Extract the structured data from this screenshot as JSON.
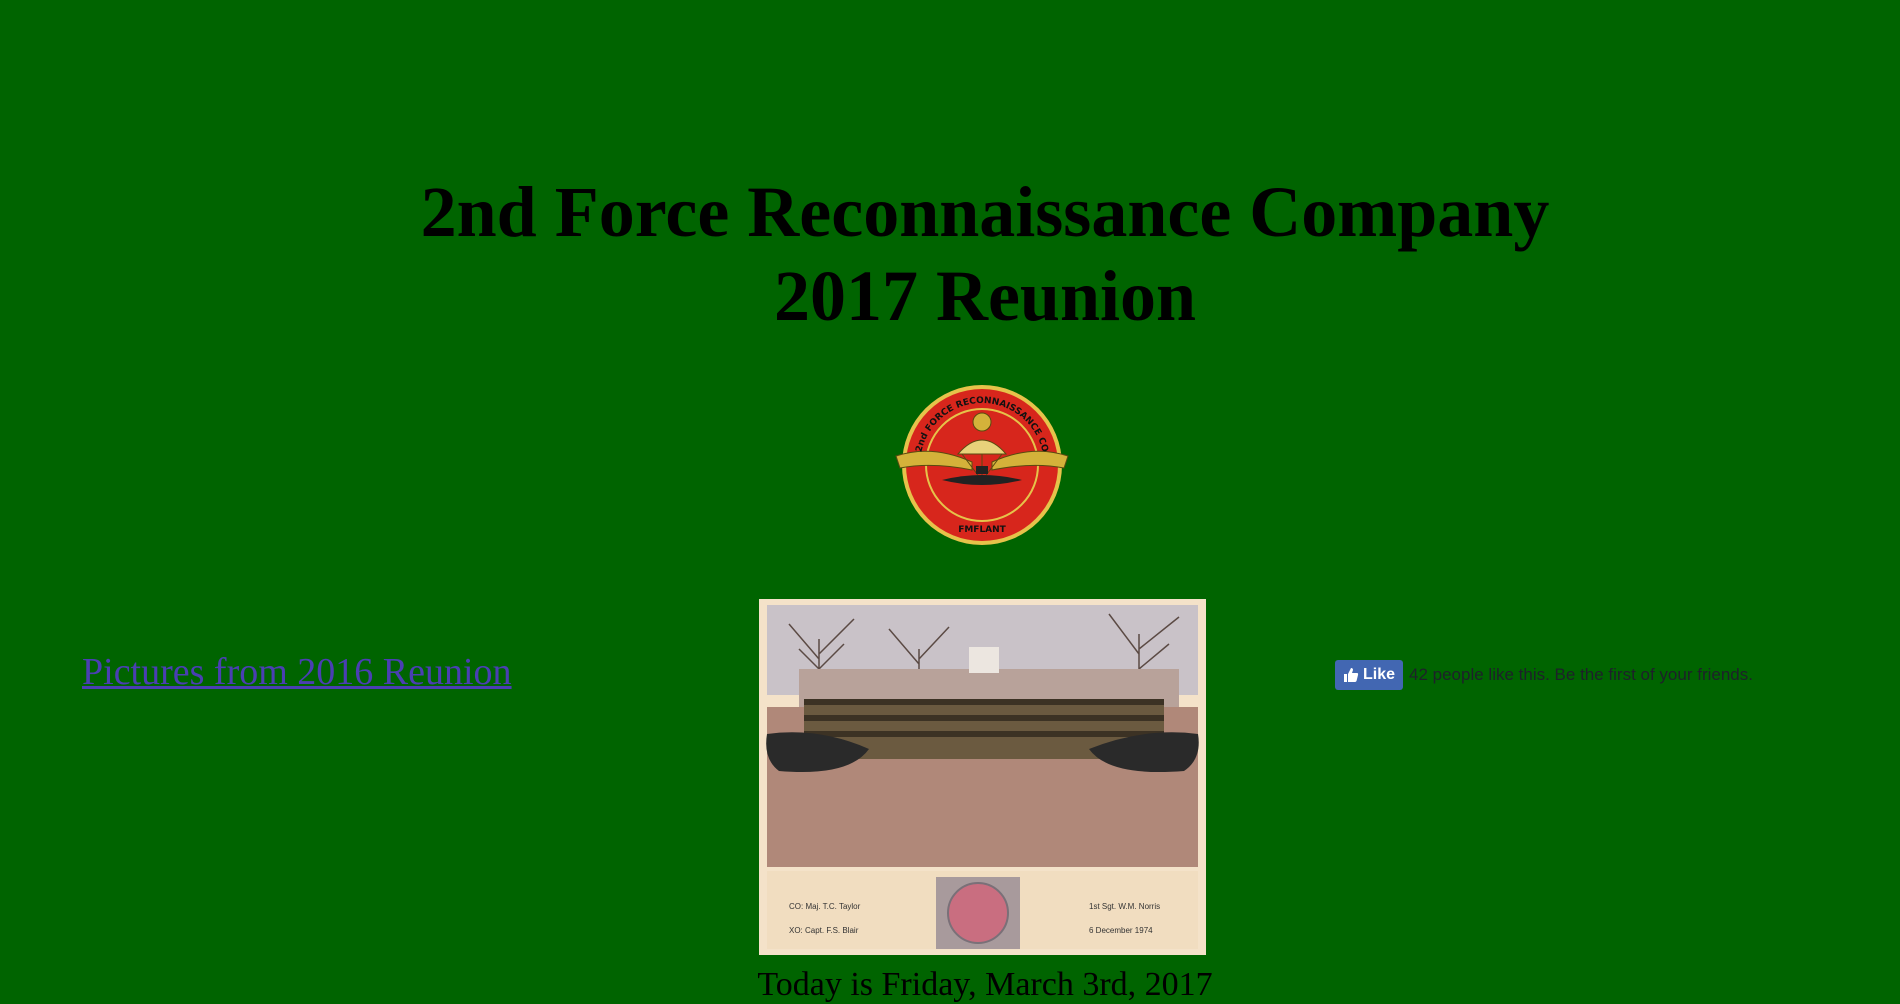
{
  "header": {
    "title_line1": "2nd Force Reconnaissance Company",
    "title_line2": "2017 Reunion"
  },
  "emblem": {
    "ring_text": "2nd FORCE RECONNAISSANCE CO",
    "bottom_text": "FMFLANT"
  },
  "photo": {
    "caption_left_1": "CO: Maj. T.C. Taylor",
    "caption_left_2": "XO: Capt. F.S. Blair",
    "caption_right_1": "1st Sgt. W.M. Norris",
    "caption_right_2": "6 December 1974"
  },
  "links": {
    "past_reunion": "Pictures from 2016 Reunion"
  },
  "facebook": {
    "like_label": "Like",
    "count_text": "42 people like this. Be the first of your friends."
  },
  "date_line": "Today is Friday, March 3rd, 2017",
  "colors": {
    "background": "#006400",
    "link": "#4a3fb3",
    "fb_button": "#4267b2",
    "emblem_red": "#d7261c",
    "emblem_gold": "#d4b23a"
  }
}
